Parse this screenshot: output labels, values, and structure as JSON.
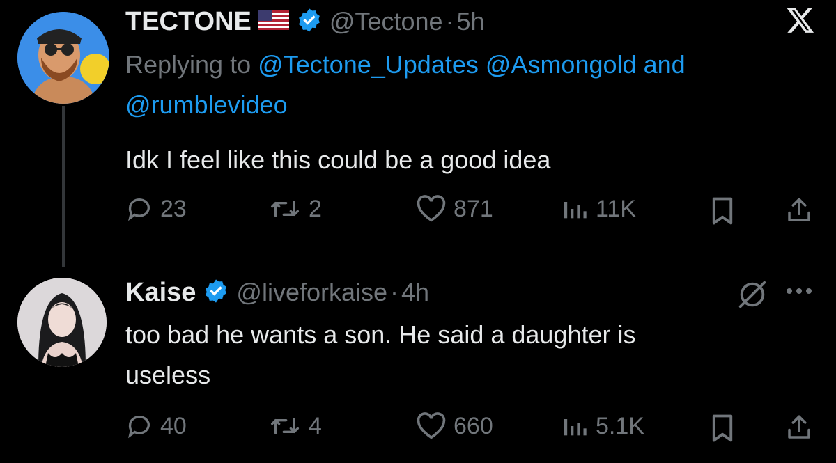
{
  "tweet1": {
    "name": "TECTONE",
    "handle": "@Tectone",
    "time": "5h",
    "replying_prefix": "Replying to",
    "replying_to": [
      "@Tectone_Updates",
      "@Asmongold"
    ],
    "replying_and": "and",
    "replying_to_last": "@rumblevideo",
    "text": "Idk I feel like this could be a good idea",
    "stats": {
      "replies": "23",
      "reposts": "2",
      "likes": "871",
      "views": "11K"
    }
  },
  "tweet2": {
    "name": "Kaise",
    "handle": "@liveforkaise",
    "time": "4h",
    "text_line1": "too bad he wants a son. He said a daughter is",
    "text_line2": "useless",
    "stats": {
      "replies": "40",
      "reposts": "4",
      "likes": "660",
      "views": "5.1K"
    }
  },
  "separator": "·",
  "colors": {
    "background": "#000000",
    "accent": "#1d9bf0",
    "muted": "#71767b",
    "text": "#e7e9ea"
  },
  "icons": [
    "x-logo-icon",
    "verified-badge-icon",
    "us-flag-icon",
    "reply-icon",
    "repost-icon",
    "like-icon",
    "views-icon",
    "bookmark-icon",
    "share-icon",
    "grok-icon",
    "more-icon"
  ]
}
